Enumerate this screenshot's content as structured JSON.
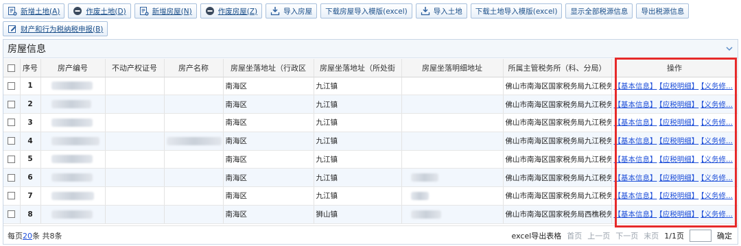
{
  "toolbar": {
    "row1": [
      {
        "label": "新增土地(A)",
        "icon": "add-doc-icon",
        "underline": true
      },
      {
        "label": "作废土地(D)",
        "icon": "minus-circle-icon",
        "underline": true
      },
      {
        "label": "新增房屋(N)",
        "icon": "add-doc-icon",
        "underline": true
      },
      {
        "label": "作废房屋(Z)",
        "icon": "minus-circle-icon",
        "underline": true
      },
      {
        "label": "导入房屋",
        "icon": "import-icon",
        "underline": false
      },
      {
        "label": "下载房屋导入模版(excel)",
        "icon": "",
        "underline": false
      },
      {
        "label": "导入土地",
        "icon": "import-icon",
        "underline": false
      },
      {
        "label": "下载土地导入模版(excel)",
        "icon": "",
        "underline": false
      },
      {
        "label": "显示全部税源信息",
        "icon": "",
        "underline": false
      },
      {
        "label": "导出税源信息",
        "icon": "",
        "underline": false
      }
    ],
    "row2": [
      {
        "label": "财产和行为税纳税申报(B)",
        "icon": "edit-icon",
        "underline": true
      }
    ]
  },
  "panel": {
    "title": "房屋信息"
  },
  "table": {
    "headers": [
      "序号",
      "房产编号",
      "不动产权证号",
      "房产名称",
      "房屋坐落地址（行政区",
      "房屋坐落地址（所处街",
      "房屋坐落明细地址",
      "所属主管税务所（科、分局）",
      "操作"
    ],
    "rows": [
      {
        "seq": "1",
        "district": "南海区",
        "street": "九江镇",
        "office": "佛山市南海区国家税务局九江税务..."
      },
      {
        "seq": "2",
        "district": "南海区",
        "street": "九江镇",
        "office": "佛山市南海区国家税务局九江税务..."
      },
      {
        "seq": "3",
        "district": "南海区",
        "street": "九江镇",
        "office": "佛山市南海区国家税务局九江税务..."
      },
      {
        "seq": "4",
        "district": "南海区",
        "street": "九江镇",
        "office": "佛山市南海区国家税务局九江税务..."
      },
      {
        "seq": "5",
        "district": "南海区",
        "street": "九江镇",
        "office": "佛山市南海区国家税务局九江税务..."
      },
      {
        "seq": "6",
        "district": "南海区",
        "street": "九江镇",
        "office": "佛山市南海区国家税务局九江税务..."
      },
      {
        "seq": "7",
        "district": "南海区",
        "street": "九江镇",
        "office": "佛山市南海区国家税务局九江税务..."
      },
      {
        "seq": "8",
        "district": "南海区",
        "street": "狮山镇",
        "office": "佛山市南海区国家税务局西樵税务..."
      }
    ],
    "ops": [
      "【基本信息】",
      "【应税明细】",
      "【义务修..."
    ]
  },
  "footer": {
    "per_page_prefix": "每页",
    "per_page_count": "20",
    "per_page_suffix": "条 共8条",
    "export": "excel导出表格",
    "first": "首页",
    "prev": "上一页",
    "next": "下一页",
    "last": "末页",
    "page_info": "1/1页",
    "go": "确定"
  },
  "colors": {
    "accent": "#1d4ed8",
    "highlight": "#e62a2a",
    "alt_row": "#f2f7fd"
  }
}
